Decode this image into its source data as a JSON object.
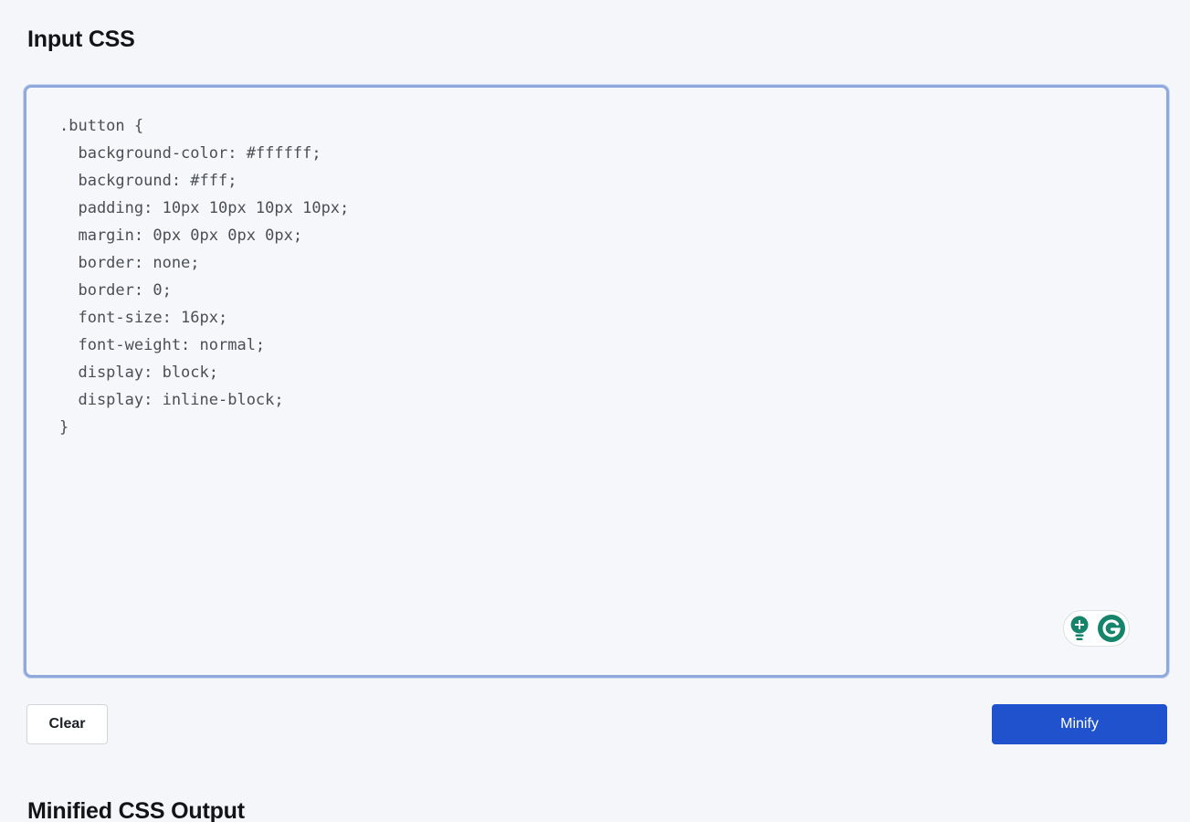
{
  "input_section": {
    "title": "Input CSS",
    "code": ".button {\n  background-color: #ffffff;\n  background: #fff;\n  padding: 10px 10px 10px 10px;\n  margin: 0px 0px 0px 0px;\n  border: none;\n  border: 0;\n  font-size: 16px;\n  font-weight: normal;\n  display: block;\n  display: inline-block;\n}"
  },
  "actions": {
    "clear_label": "Clear",
    "minify_label": "Minify"
  },
  "output_section": {
    "title": "Minified CSS Output"
  },
  "grammarly_widget": {
    "icons": [
      "lightbulb-icon",
      "grammarly-logo-icon"
    ]
  },
  "colors": {
    "accent": "#1f52cc",
    "focus_border": "#8fa8dd",
    "grammarly_green": "#15846b"
  }
}
